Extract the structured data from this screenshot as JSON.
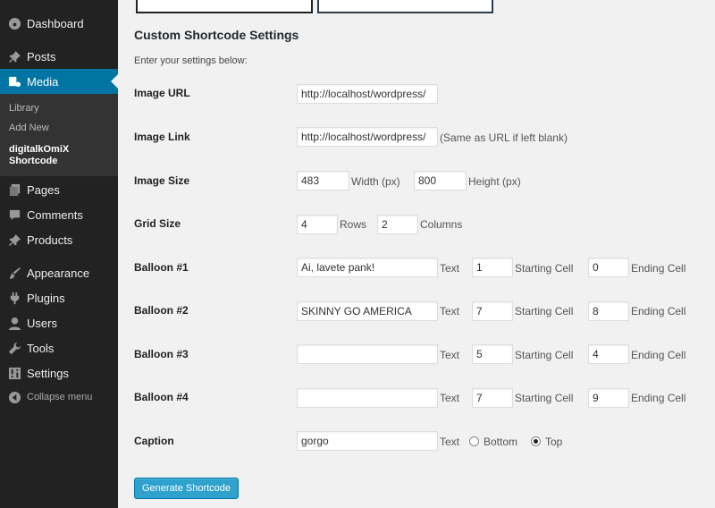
{
  "sidebar": {
    "items": [
      {
        "label": "Dashboard",
        "icon": "dashboard-icon"
      },
      {
        "label": "Posts",
        "icon": "pin-icon"
      },
      {
        "label": "Media",
        "icon": "media-icon"
      },
      {
        "label": "Pages",
        "icon": "pages-icon"
      },
      {
        "label": "Comments",
        "icon": "comments-icon"
      },
      {
        "label": "Products",
        "icon": "pin-icon"
      },
      {
        "label": "Appearance",
        "icon": "appearance-icon"
      },
      {
        "label": "Plugins",
        "icon": "plugins-icon"
      },
      {
        "label": "Users",
        "icon": "users-icon"
      },
      {
        "label": "Tools",
        "icon": "tools-icon"
      },
      {
        "label": "Settings",
        "icon": "settings-icon"
      }
    ],
    "submenu": {
      "library": "Library",
      "add_new": "Add New",
      "current_line1": "digitalkOmiX",
      "current_line2": "Shortcode"
    },
    "collapse": "Collapse menu",
    "active_color": "#0074a2"
  },
  "page": {
    "title": "Custom Shortcode Settings",
    "intro": "Enter your settings below:"
  },
  "form": {
    "image_url": {
      "label": "Image URL",
      "value": "http://localhost/wordpress/"
    },
    "image_link": {
      "label": "Image Link",
      "value": "http://localhost/wordpress/",
      "note": "(Same as URL if left blank)"
    },
    "image_size": {
      "label": "Image Size",
      "width": "483",
      "width_label": "Width (px)",
      "height": "800",
      "height_label": "Height (px)"
    },
    "grid_size": {
      "label": "Grid Size",
      "rows": "4",
      "rows_label": "Rows",
      "columns": "2",
      "columns_label": "Columns"
    },
    "text_label": "Text",
    "start_label": "Starting Cell",
    "end_label": "Ending Cell",
    "balloons": [
      {
        "label": "Balloon #1",
        "text": "Ai, lavete pank!",
        "start": "1",
        "end": "0"
      },
      {
        "label": "Balloon #2",
        "text": "SKINNY GO AMERICA",
        "start": "7",
        "end": "8"
      },
      {
        "label": "Balloon #3",
        "text": "",
        "start": "5",
        "end": "4"
      },
      {
        "label": "Balloon #4",
        "text": "",
        "start": "7",
        "end": "9"
      }
    ],
    "caption": {
      "label": "Caption",
      "value": "gorgo",
      "text_label": "Text",
      "option_bottom": "Bottom",
      "option_top": "Top",
      "selected": "Top"
    },
    "generate_button": "Generate Shortcode",
    "button_color": "#2ea2cc"
  }
}
